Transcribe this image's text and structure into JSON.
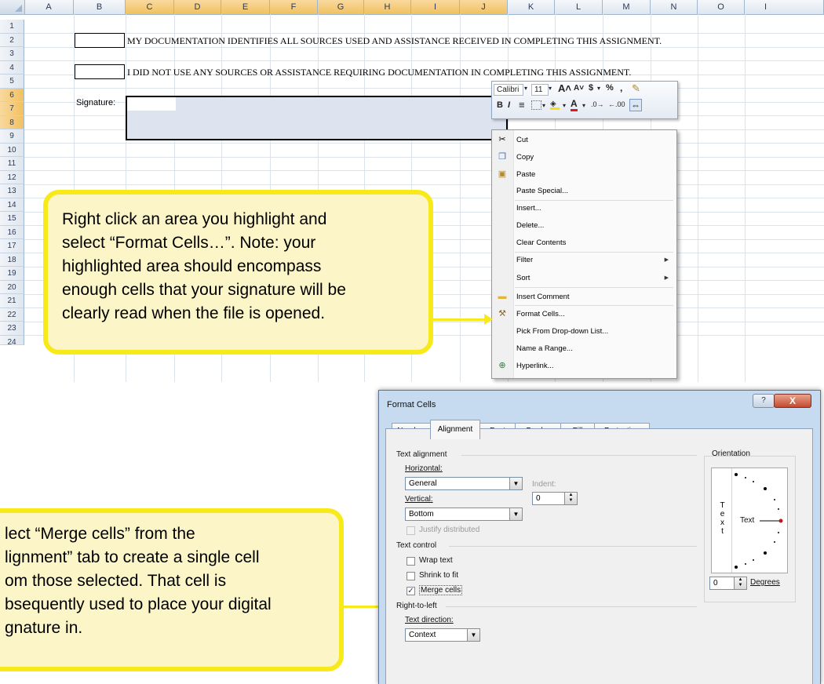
{
  "sheet": {
    "columns": [
      "A",
      "B",
      "C",
      "D",
      "E",
      "F",
      "G",
      "H",
      "I",
      "J",
      "K",
      "L",
      "M",
      "N",
      "O",
      "I"
    ],
    "rows": [
      "1",
      "2",
      "3",
      "4",
      "5",
      "6",
      "7",
      "8",
      "9",
      "10",
      "11",
      "12",
      "13",
      "14",
      "15",
      "16",
      "17",
      "18",
      "19",
      "20",
      "21",
      "22",
      "23",
      "24"
    ],
    "statement1": "MY DOCUMENTATION IDENTIFIES ALL SOURCES USED AND ASSISTANCE RECEIVED IN COMPLETING THIS ASSIGNMENT.",
    "statement2": "I DID NOT USE ANY SOURCES OR ASSISTANCE REQUIRING DOCUMENTATION IN COMPLETING THIS ASSIGNMENT.",
    "signature_label": "Signature:"
  },
  "minitoolbar": {
    "font": "Calibri",
    "size": "11",
    "grow": "A˄",
    "shrink": "A˅",
    "currency": "$",
    "percent": "%",
    "comma": ",",
    "bold": "B",
    "italic": "I",
    "center": "≡",
    "font_color": "A",
    "inc_decimal": ".0→",
    "dec_decimal": "←.00",
    "merge": "⇔"
  },
  "context_menu": {
    "items": [
      "Cut",
      "Copy",
      "Paste",
      "Paste Special...",
      "Insert...",
      "Delete...",
      "Clear Contents",
      "Filter",
      "Sort",
      "Insert Comment",
      "Format Cells...",
      "Pick From Drop-down List...",
      "Name a Range...",
      "Hyperlink..."
    ]
  },
  "callout1": {
    "lines": [
      "Right click an area you highlight and",
      "select “Format Cells…”.  Note: your",
      "highlighted area should encompass",
      "enough cells that your signature will be",
      "clearly read when the file is opened."
    ]
  },
  "callout2": {
    "lines": [
      "lect “Merge cells” from the",
      "lignment” tab to create a single cell",
      "om those selected.  That cell is",
      "bsequently used to place your digital",
      "gnature in."
    ]
  },
  "dialog": {
    "title": "Format Cells",
    "help": "?",
    "close": "X",
    "tabs": [
      "Number",
      "Alignment",
      "Font",
      "Border",
      "Fill",
      "Protection"
    ],
    "text_alignment": "Text alignment",
    "horizontal_label": "Horizontal:",
    "horizontal_value": "General",
    "indent_label": "Indent:",
    "indent_value": "0",
    "vertical_label": "Vertical:",
    "vertical_value": "Bottom",
    "justify_distributed": "Justify distributed",
    "text_control": "Text control",
    "wrap_text": "Wrap text",
    "shrink_to_fit": "Shrink to fit",
    "merge_cells": "Merge cells",
    "right_to_left": "Right-to-left",
    "text_direction_label": "Text direction:",
    "text_direction_value": "Context",
    "orientation": "Orientation",
    "orient_vertical": "T\ne\nx\nt",
    "orient_text": "Text",
    "degrees_value": "0",
    "degrees_label": "Degrees"
  }
}
